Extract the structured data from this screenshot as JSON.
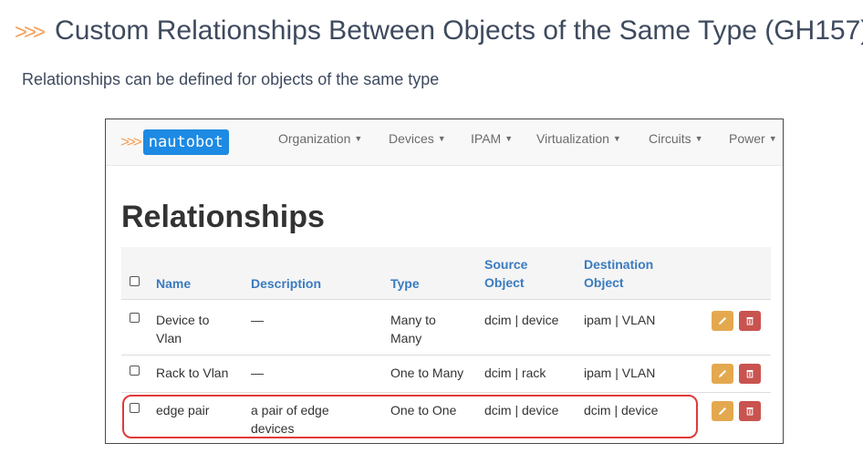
{
  "slide": {
    "title": "Custom Relationships Between Objects of the Same Type (GH157)",
    "title_chevrons": ">>>",
    "subtitle": "Relationships can be defined for objects of the same type"
  },
  "screenshot": {
    "brand": {
      "chevrons": ">>>",
      "name": "nautobot"
    },
    "nav": [
      {
        "label": "Organization"
      },
      {
        "label": "Devices"
      },
      {
        "label": "IPAM"
      },
      {
        "label": "Virtualization"
      },
      {
        "label": "Circuits"
      },
      {
        "label": "Power"
      }
    ],
    "page_title": "Relationships",
    "table": {
      "headers": {
        "name": "Name",
        "description": "Description",
        "type": "Type",
        "source_1": "Source",
        "source_2": "Object",
        "destination_1": "Destination",
        "destination_2": "Object"
      },
      "rows": [
        {
          "name_1": "Device to",
          "name_2": "Vlan",
          "description_1": "—",
          "description_2": "",
          "type_1": "Many to",
          "type_2": "Many",
          "source": "dcim | device",
          "destination": "ipam | VLAN"
        },
        {
          "name_1": "Rack to Vlan",
          "name_2": "",
          "description_1": "—",
          "description_2": "",
          "type_1": "One to Many",
          "type_2": "",
          "source": "dcim | rack",
          "destination": "ipam | VLAN"
        },
        {
          "name_1": "edge pair",
          "name_2": "",
          "description_1": "a pair of edge",
          "description_2": "devices",
          "type_1": "One to One",
          "type_2": "",
          "source": "dcim | device",
          "destination": "dcim | device"
        }
      ]
    },
    "colors": {
      "accent_chevron": "#f5a05a",
      "brand_bg": "#1d8ae3",
      "link_header": "#3a7bbf",
      "edit_button": "#e4a94f",
      "delete_button": "#c9534f",
      "highlight": "#e03a3a"
    },
    "icons": {
      "edit": "pencil-icon",
      "delete": "trash-icon",
      "nav_caret": "caret-down-icon"
    }
  }
}
